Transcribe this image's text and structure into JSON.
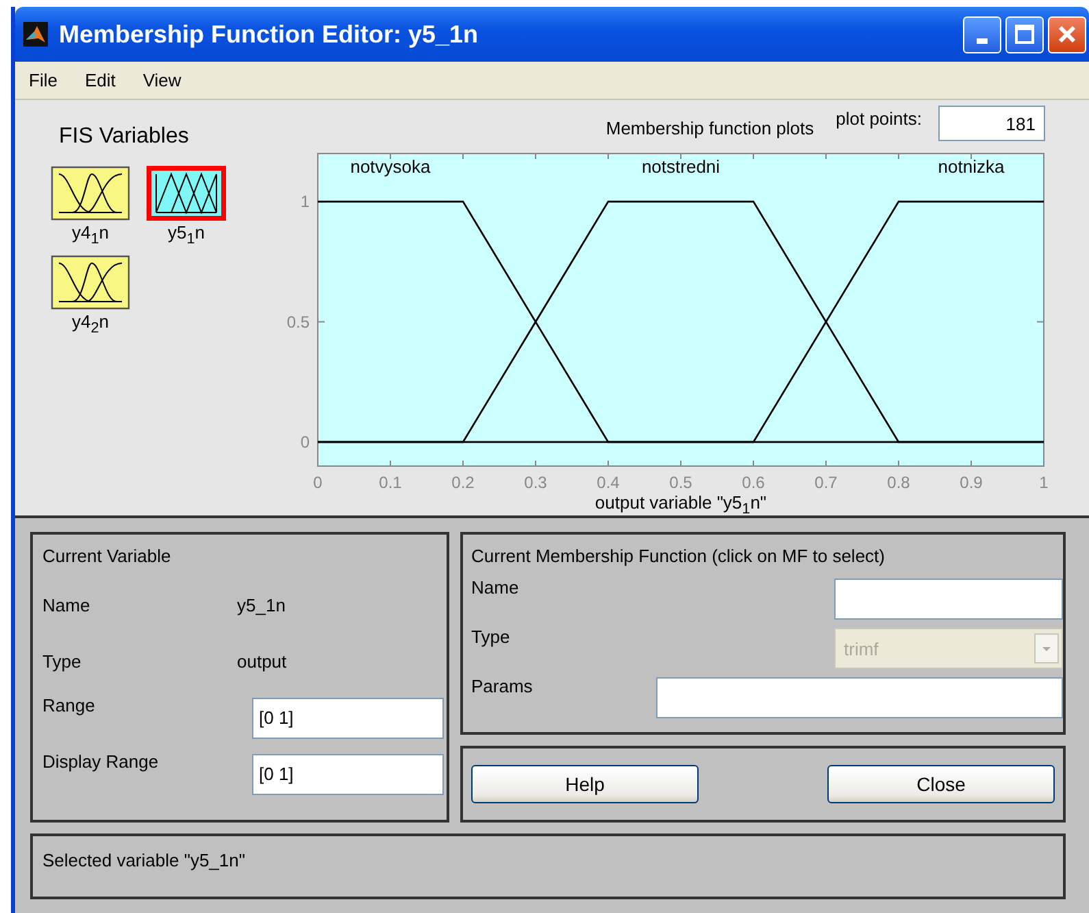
{
  "window": {
    "title": "Membership Function Editor: y5_1n"
  },
  "menu": [
    "File",
    "Edit",
    "View"
  ],
  "fis_variables": {
    "title": "FIS Variables",
    "items": [
      {
        "label": "y4$_{1}$n",
        "kind": "input",
        "selected": false
      },
      {
        "label": "y5$_{1}$n",
        "kind": "output",
        "selected": true
      },
      {
        "label": "y4$_{2}$n",
        "kind": "input",
        "selected": false
      }
    ]
  },
  "plot": {
    "title": "Membership function plots",
    "plot_points_label": "plot points:",
    "plot_points": "181",
    "chart_data": {
      "type": "line",
      "xlabel": "output variable \"y5$_{1}$n\"",
      "x": [
        0,
        0.2,
        0.4,
        0.6,
        0.8,
        1
      ],
      "series": [
        {
          "name": "notvysoka",
          "color": "#000000",
          "values": [
            1,
            1,
            0,
            0,
            0,
            0
          ]
        },
        {
          "name": "notstredni",
          "color": "#000000",
          "values": [
            0,
            0,
            1,
            1,
            0,
            0
          ]
        },
        {
          "name": "notnizka",
          "color": "#000000",
          "values": [
            0,
            0,
            0,
            0,
            1,
            1
          ]
        }
      ],
      "xlim": [
        0,
        1
      ],
      "ylim": [
        -0.1,
        1.2
      ],
      "xticks": [
        0,
        0.1,
        0.2,
        0.3,
        0.4,
        0.5,
        0.6,
        0.7,
        0.8,
        0.9,
        1
      ],
      "yticks": [
        0,
        0.5,
        1
      ]
    }
  },
  "current_variable": {
    "title": "Current Variable",
    "rows": [
      {
        "label": "Name",
        "kind": "text",
        "value": "y5_1n"
      },
      {
        "label": "Type",
        "kind": "text",
        "value": "output"
      },
      {
        "label": "Range",
        "kind": "field",
        "value": "[0 1]"
      },
      {
        "label": "Display Range",
        "kind": "field",
        "value": "[0 1]"
      }
    ]
  },
  "current_mf": {
    "title": "Current Membership Function (click on MF to select)",
    "rows": [
      {
        "label": "Name",
        "kind": "field"
      },
      {
        "label": "Type",
        "kind": "dropdown",
        "value": "trimf",
        "disabled": true
      },
      {
        "label": "Params",
        "kind": "wide_field"
      }
    ]
  },
  "buttons": [
    "Help",
    "Close"
  ],
  "status_bar": "Selected variable \"y5_1n\""
}
